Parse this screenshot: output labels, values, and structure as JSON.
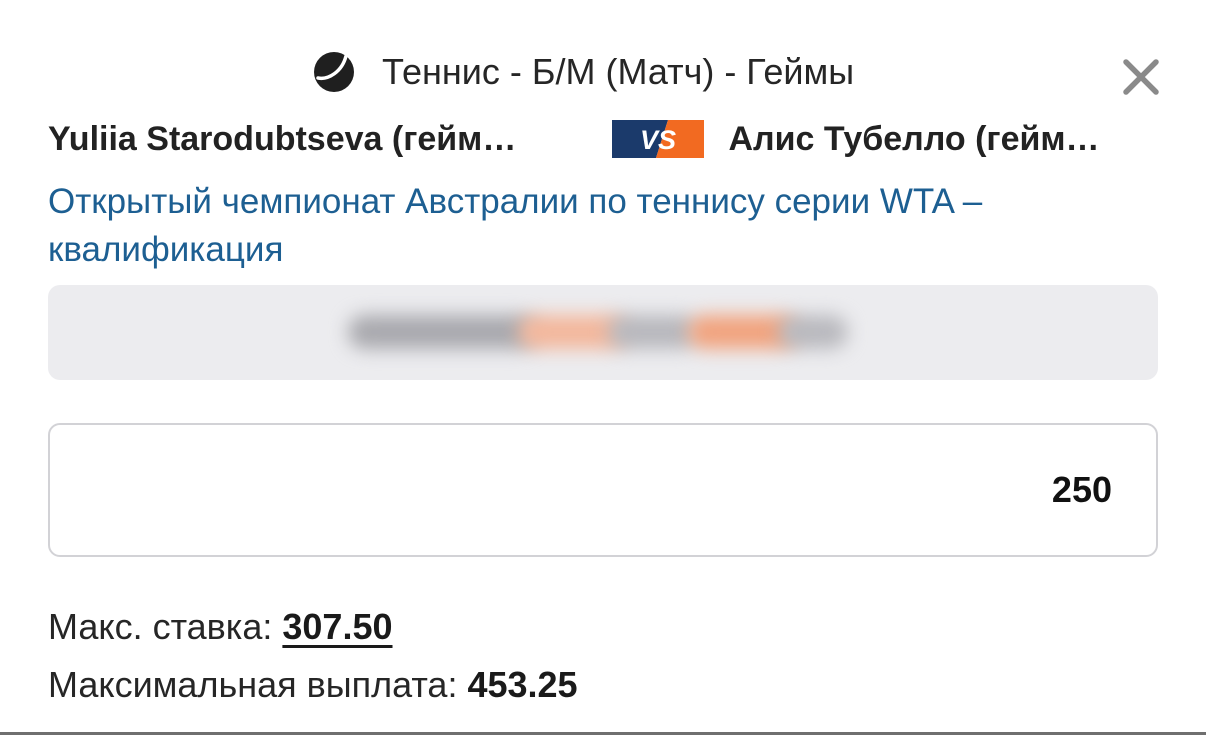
{
  "header": {
    "title": "Теннис - Б/М (Матч) - Геймы",
    "sport_icon": "tennis-ball-icon",
    "close_icon": "close-icon"
  },
  "match": {
    "team1": "Yuliia Starodubtseva (гейм…",
    "vs_label": "VS",
    "team2": "Алис Тубелло (гейм…",
    "tournament": "Открытый чемпионат Австралии по теннису серии WTA – квалификация"
  },
  "colors": {
    "tournament_link": "#1d5f92",
    "vs_dark": "#1b3a6b",
    "vs_orange": "#f26a21",
    "blurred_panel": "#ececef"
  },
  "stake": {
    "value": "250"
  },
  "limits": {
    "max_stake_label": "Макс. ставка:",
    "max_stake_value": "307.50",
    "max_payout_label": "Максимальная выплата:",
    "max_payout_value": "453.25"
  }
}
